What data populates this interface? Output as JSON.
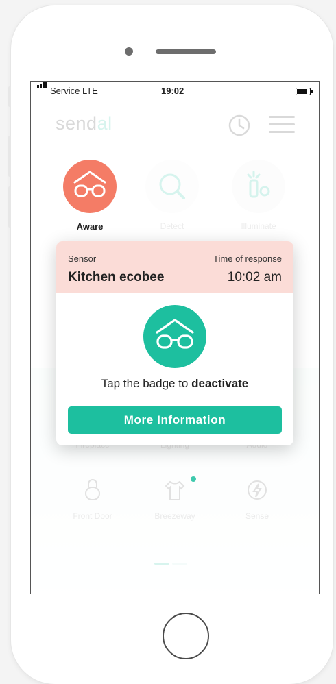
{
  "status_bar": {
    "carrier": "Service  LTE",
    "time": "19:02"
  },
  "header": {
    "logo_prefix": "send",
    "logo_accent": "al",
    "history_icon": "clock-history-icon",
    "menu_icon": "hamburger-menu-icon"
  },
  "modes": [
    {
      "label": "Aware",
      "icon": "glasses-house-icon",
      "active": true
    },
    {
      "label": "Detect",
      "icon": "magnifier-icon",
      "active": false
    },
    {
      "label": "Illuminate",
      "icon": "lights-icon",
      "active": false
    }
  ],
  "tiles_row1": [
    "Fireplace",
    "Lighting",
    "Audio"
  ],
  "tiles_row2": [
    {
      "label": "Front Door",
      "icon": "lock-icon"
    },
    {
      "label": "Breezeway",
      "icon": "shirt-icon",
      "dot": true
    },
    {
      "label": "Sense",
      "icon": "bolt-icon"
    }
  ],
  "popup": {
    "sensor_label": "Sensor",
    "sensor_name": "Kitchen ecobee",
    "time_label": "Time of response",
    "time_value": "10:02 am",
    "tap_text": "Tap the badge to ",
    "tap_action": "deactivate",
    "button_label": "More Information"
  },
  "colors": {
    "accent": "#1dbf9f",
    "aware": "#f47c66",
    "popup_header": "#fbdcd7"
  }
}
